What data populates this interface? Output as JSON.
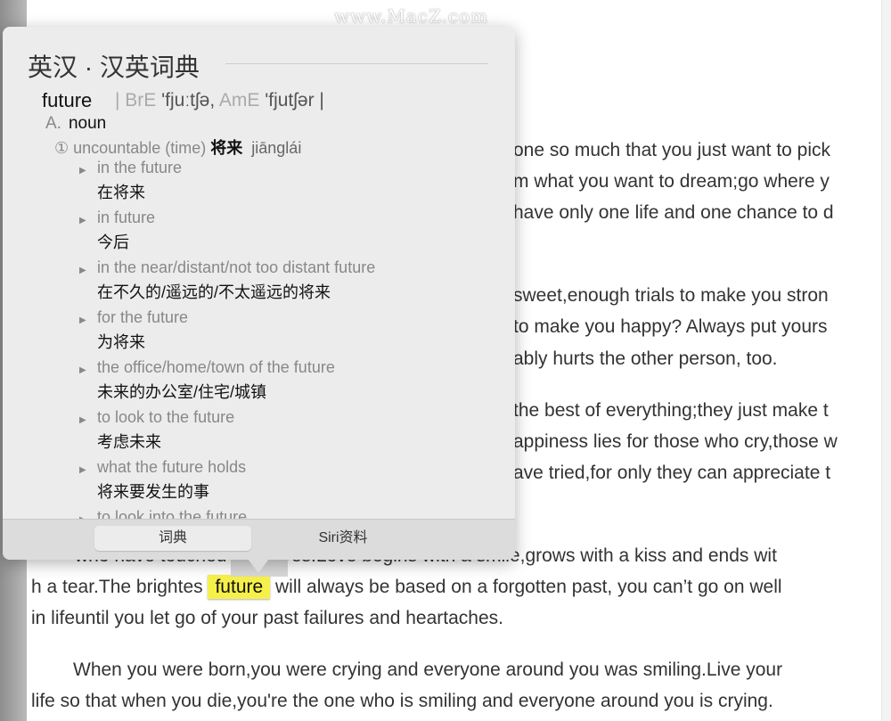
{
  "watermark": "www.MacZ.com",
  "document": {
    "lines": [
      "one so much that you just want to pick",
      "m what you want to dream;go where y",
      "have only one life and one chance to d",
      "sweet,enough trials to make you stron",
      "to make you happy? Always put yours",
      "ably hurts the other person, too.",
      "the best of everything;they just make t",
      "appiness lies for those who cry,those w",
      "ave tried,for only they can appreciate t"
    ],
    "line_who": "who have touched their lives.Love begins with a smile,grows with a kiss and ends wit",
    "line_tear_before": "h a tear.The brightes",
    "highlighted_word": "future",
    "line_tear_after": "will always be based on a forgotten past, you can’t go on well",
    "line_life": "in lifeuntil you let go of your past failures and heartaches.",
    "para_born_1": "When you were born,you were crying and everyone around you was smiling.Live your",
    "para_born_2": "life so that when you die,you're the one who is smiling and everyone around you is crying."
  },
  "popup": {
    "title": "英汉 · 汉英词典",
    "headword": "future",
    "pron_bre_label": "| BrE",
    "pron_bre": "'fjuːtʃə,",
    "pron_ame_label": "AmE",
    "pron_ame": "'fjutʃər |",
    "pos_letter": "A.",
    "pos": "noun",
    "sense_num": "①",
    "sense_label": "uncountable (time)",
    "sense_zh": "将来",
    "sense_pinyin": "jiānglái",
    "examples": [
      {
        "en": "in the future",
        "zh": "在将来"
      },
      {
        "en": "in future",
        "zh": "今后"
      },
      {
        "en": "in the near/distant/not too distant future",
        "zh": "在不久的/遥远的/不太遥远的将来"
      },
      {
        "en": "for the future",
        "zh": "为将来"
      },
      {
        "en": "the office/home/town of the future",
        "zh": "未来的办公室/住宅/城镇"
      },
      {
        "en": "to look to the future",
        "zh": "考虑未来"
      },
      {
        "en": "what the future holds",
        "zh": "将来要发生的事"
      },
      {
        "en": "to look into the future",
        "zh": ""
      }
    ],
    "tabs": [
      {
        "label": "词典",
        "active": true
      },
      {
        "label": "Siri资料",
        "active": false
      }
    ]
  },
  "colors": {
    "highlight": "#f6f14a",
    "popup_bg": "#ececec"
  }
}
